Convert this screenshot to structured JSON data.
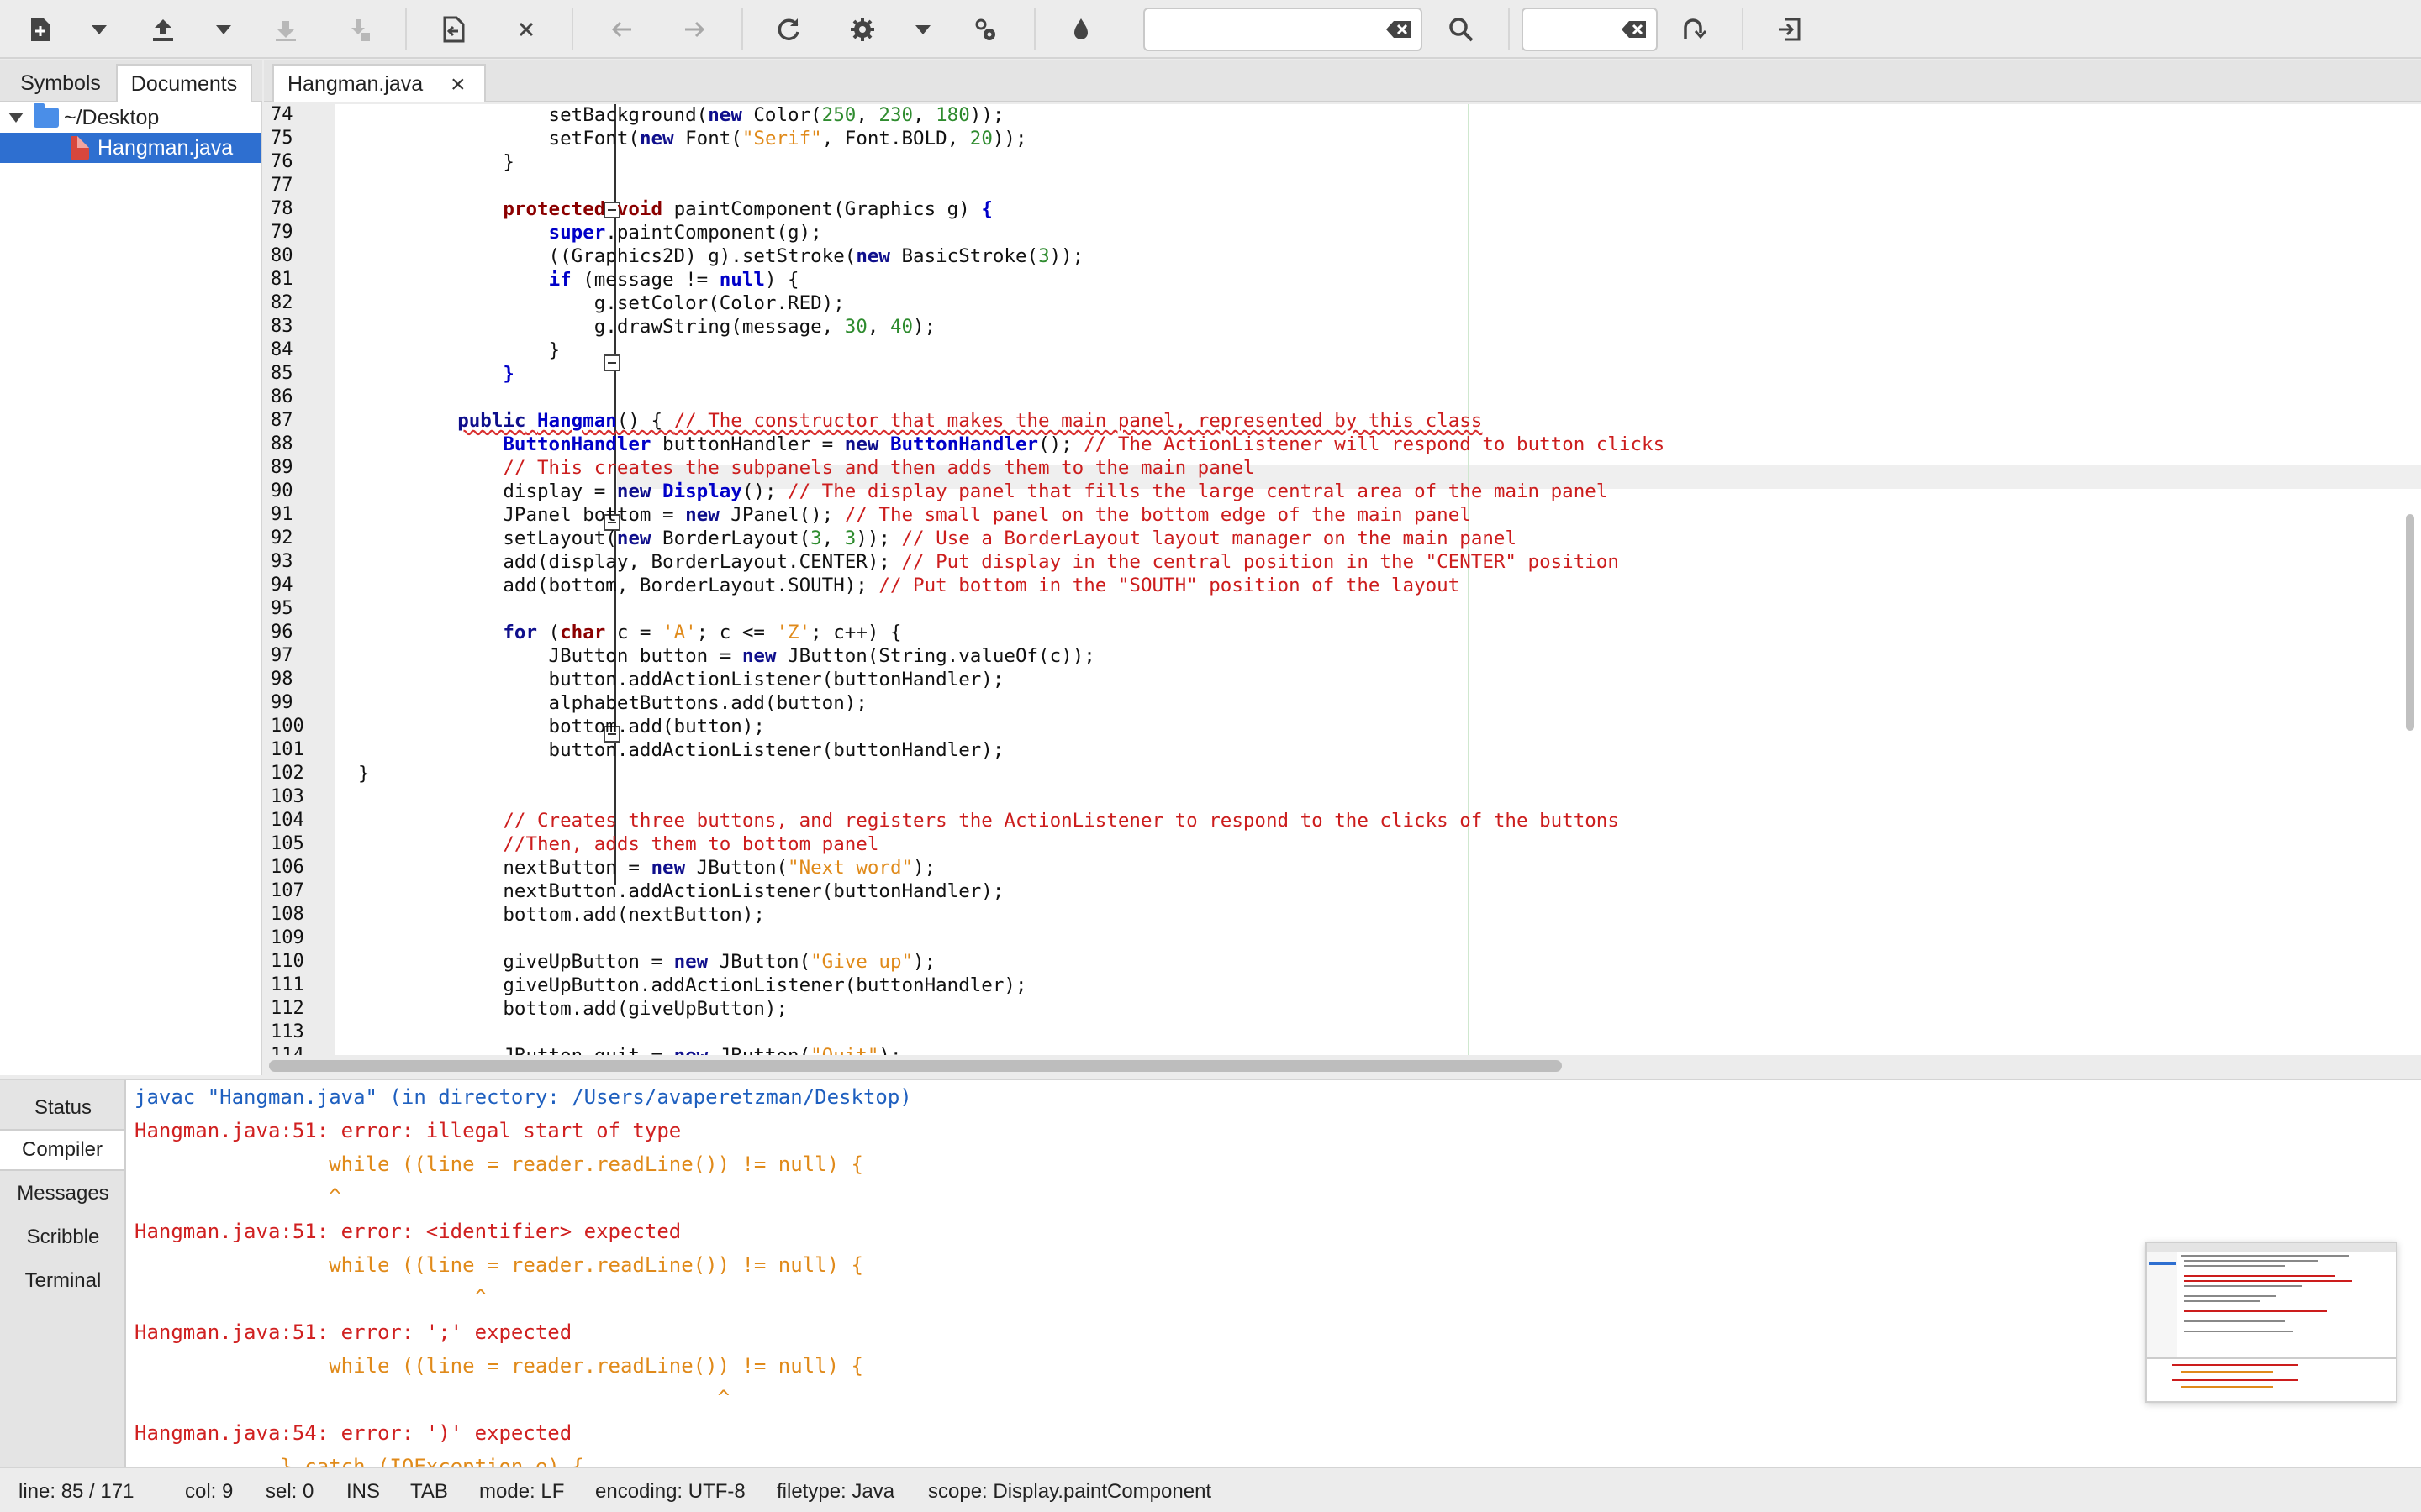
{
  "toolbar": {
    "icons": [
      "new-file-icon",
      "open-file-icon",
      "save-icon",
      "save-all-icon",
      "revert-icon",
      "close-icon",
      "back-icon",
      "forward-icon",
      "reload-icon",
      "settings-icon",
      "build-settings-icon",
      "color-picker-icon",
      "search-icon",
      "jump-to-line-icon",
      "quit-icon"
    ],
    "search_value": "",
    "goto_value": ""
  },
  "sidebar": {
    "tabs": [
      "Symbols",
      "Documents"
    ],
    "active_tab": "Documents",
    "folder": "~/Desktop",
    "file": "Hangman.java"
  },
  "editor": {
    "tab_label": "Hangman.java",
    "lines": [
      {
        "n": "74"
      },
      {
        "n": "75"
      },
      {
        "n": "76"
      },
      {
        "n": "77"
      },
      {
        "n": "78"
      },
      {
        "n": "79"
      },
      {
        "n": "80"
      },
      {
        "n": "81"
      },
      {
        "n": "82"
      },
      {
        "n": "83"
      },
      {
        "n": "84"
      },
      {
        "n": "85"
      },
      {
        "n": "86"
      },
      {
        "n": "87"
      },
      {
        "n": "88"
      },
      {
        "n": "89"
      },
      {
        "n": "90"
      },
      {
        "n": "91"
      },
      {
        "n": "92"
      },
      {
        "n": "93"
      },
      {
        "n": "94"
      },
      {
        "n": "95"
      },
      {
        "n": "96"
      },
      {
        "n": "97"
      },
      {
        "n": "98"
      },
      {
        "n": "99"
      },
      {
        "n": "100"
      },
      {
        "n": "101"
      },
      {
        "n": "102"
      },
      {
        "n": "103"
      },
      {
        "n": "104"
      },
      {
        "n": "105"
      },
      {
        "n": "106"
      },
      {
        "n": "107"
      },
      {
        "n": "108"
      },
      {
        "n": "109"
      },
      {
        "n": "110"
      },
      {
        "n": "111"
      },
      {
        "n": "112"
      },
      {
        "n": "113"
      },
      {
        "n": "114"
      }
    ],
    "code": {
      "l74a": "            setBackground(",
      "l74b": "new",
      "l74c": " Color(",
      "l74d": "250",
      "l74e": ", ",
      "l74f": "230",
      "l74g": ", ",
      "l74h": "180",
      "l74i": "));",
      "l75a": "            setFont(",
      "l75b": "new",
      "l75c": " Font(",
      "l75d": "\"Serif\"",
      "l75e": ", Font.BOLD, ",
      "l75f": "20",
      "l75g": "));",
      "l76": "        }",
      "l78a": "        ",
      "l78b": "protected",
      "l78c": " ",
      "l78d": "void",
      "l78e": " paintComponent(Graphics g) ",
      "l78f": "{",
      "l79a": "            ",
      "l79b": "super",
      "l79c": ".paintComponent(g);",
      "l80a": "            ((Graphics2D) g).setStroke(",
      "l80b": "new",
      "l80c": " BasicStroke(",
      "l80d": "3",
      "l80e": "));",
      "l81a": "            ",
      "l81b": "if",
      "l81c": " (message != ",
      "l81d": "null",
      "l81e": ") {",
      "l82": "                g.setColor(Color.RED);",
      "l83a": "                g.drawString(message, ",
      "l83b": "30",
      "l83c": ", ",
      "l83d": "40",
      "l83e": ");",
      "l84": "            }",
      "l85": "        }",
      "l87a": "    ",
      "l87b": "public",
      "l87c": " ",
      "l87d": "Hangman",
      "l87e": "() { ",
      "l87f": "// The constructor that makes the main panel, represented by this class",
      "l88a": "        ",
      "l88b": "ButtonHandler",
      "l88c": " buttonHandler = ",
      "l88d": "new",
      "l88e": " ",
      "l88f": "ButtonHandler",
      "l88g": "(); ",
      "l88h": "// The ActionListener will respond to button clicks",
      "l89": "        // This creates the subpanels and then adds them to the main panel",
      "l90a": "        display = ",
      "l90b": "new",
      "l90c": " ",
      "l90d": "Display",
      "l90e": "(); ",
      "l90f": "// The display panel that fills the large central area of the main panel",
      "l91a": "        JPanel bottom = ",
      "l91b": "new",
      "l91c": " JPanel(); ",
      "l91d": "// The small panel on the bottom edge of the main panel",
      "l92a": "        setLayout(",
      "l92b": "new",
      "l92c": " BorderLayout(",
      "l92d": "3",
      "l92e": ", ",
      "l92f": "3",
      "l92g": ")); ",
      "l92h": "// Use a BorderLayout layout manager on the main panel",
      "l93a": "        add(display, BorderLayout.CENTER); ",
      "l93b": "// Put display in the central position in the \"CENTER\" position",
      "l94a": "        add(bottom, BorderLayout.SOUTH); ",
      "l94b": "// Put bottom in the \"SOUTH\" position of the layout",
      "l96a": "        ",
      "l96b": "for",
      "l96c": " (",
      "l96d": "char",
      "l96e": " c = ",
      "l96f": "'A'",
      "l96g": "; c <= ",
      "l96h": "'Z'",
      "l96i": "; c++) {",
      "l97a": "            JButton button = ",
      "l97b": "new",
      "l97c": " JButton(String.valueOf(c));",
      "l98": "            button.addActionListener(buttonHandler);",
      "l99": "            alphabetButtons.add(button);",
      "l100": "            bottom.add(button);",
      "l101": "            button.addActionListener(buttonHandler);",
      "l102": "}",
      "l104": "        // Creates three buttons, and registers the ActionListener to respond to the clicks of the buttons",
      "l105": "        //Then, adds them to bottom panel",
      "l106a": "        nextButton = ",
      "l106b": "new",
      "l106c": " JButton(",
      "l106d": "\"Next word\"",
      "l106e": ");",
      "l107": "        nextButton.addActionListener(buttonHandler);",
      "l108": "        bottom.add(nextButton);",
      "l110a": "        giveUpButton = ",
      "l110b": "new",
      "l110c": " JButton(",
      "l110d": "\"Give up\"",
      "l110e": ");",
      "l111": "        giveUpButton.addActionListener(buttonHandler);",
      "l112": "        bottom.add(giveUpButton);",
      "l114a": "        JButton quit = ",
      "l114b": "new",
      "l114c": " JButton(",
      "l114d": "\"Quit\"",
      "l114e": ");"
    }
  },
  "bottom_panel": {
    "tabs": [
      "Status",
      "Compiler",
      "Messages",
      "Scribble",
      "Terminal"
    ],
    "active_tab": "Compiler",
    "log": [
      "javac \"Hangman.java\" (in directory: /Users/avaperetzman/Desktop)",
      "Hangman.java:51: error: illegal start of type",
      "                while ((line = reader.readLine()) != null) {",
      "                ^",
      "Hangman.java:51: error: <identifier> expected",
      "                while ((line = reader.readLine()) != null) {",
      "                            ^",
      "Hangman.java:51: error: ';' expected",
      "                while ((line = reader.readLine()) != null) {",
      "                                                ^",
      "Hangman.java:54: error: ')' expected",
      "            } catch (IOException e) {"
    ]
  },
  "statusbar": {
    "line": "line: 85 / 171",
    "col": "col: 9",
    "sel": "sel: 0",
    "ins": "INS",
    "tab": "TAB",
    "mode": "mode: LF",
    "encoding": "encoding: UTF-8",
    "filetype": "filetype: Java",
    "scope": "scope: Display.paintComponent"
  },
  "colors": {
    "keyword": "#0f0f8c",
    "keyword_alt": "#8b0000",
    "type": "#0000c8",
    "number": "#2e8b2e",
    "string": "#e08a1a",
    "comment": "#cc1d1d",
    "selection": "#2e6fd0"
  }
}
